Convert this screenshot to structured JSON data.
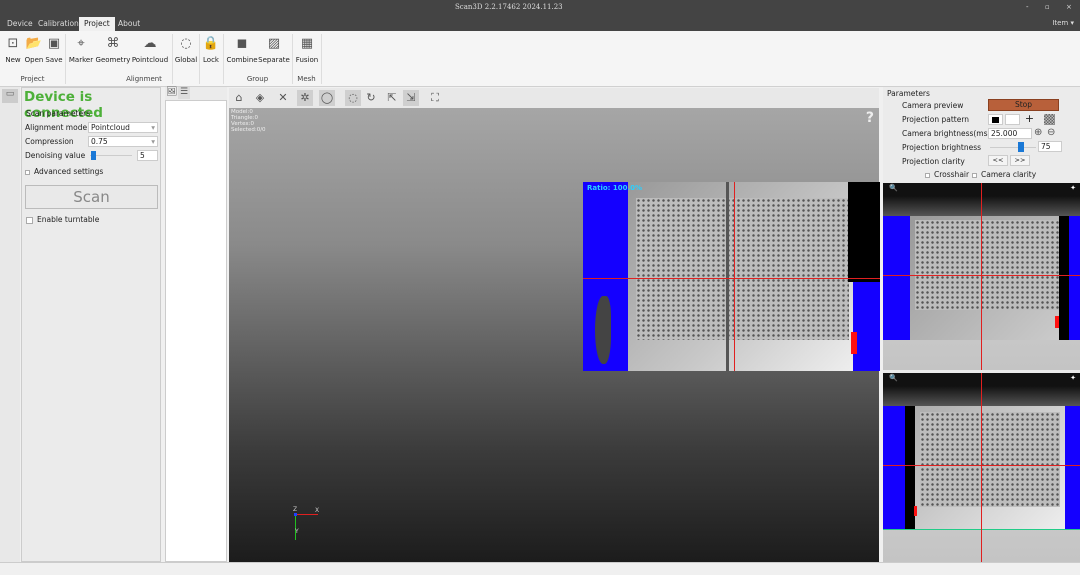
{
  "window": {
    "title": "Scan3D 2.2.17462 2024.11.23",
    "minimize": "-",
    "maximize": "▫",
    "close": "×",
    "item_menu": "Item ▾"
  },
  "tabs": [
    "Device",
    "Calibration",
    "Project",
    "About"
  ],
  "ribbon": {
    "buttons": [
      {
        "label": "New",
        "icon": "new-project-icon"
      },
      {
        "label": "Open",
        "icon": "open-folder-icon"
      },
      {
        "label": "Save",
        "icon": "save-icon"
      },
      {
        "label": "Marker",
        "icon": "marker-icon"
      },
      {
        "label": "Geometry",
        "icon": "geometry-icon"
      },
      {
        "label": "Pointcloud",
        "icon": "pointcloud-icon"
      },
      {
        "label": "Global",
        "icon": "global-icon"
      },
      {
        "label": "Lock",
        "icon": "lock-icon"
      },
      {
        "label": "Combine",
        "icon": "combine-icon"
      },
      {
        "label": "Separate",
        "icon": "separate-icon"
      },
      {
        "label": "Fusion",
        "icon": "fusion-icon"
      }
    ],
    "groups": [
      "Project",
      "Alignment",
      "Group",
      "Mesh"
    ]
  },
  "left": {
    "status": "Device is connected",
    "status_color": "#4db039",
    "section": "Scan parameters",
    "alignment_label": "Alignment mode",
    "alignment_value": "Pointcloud",
    "compression_label": "Compression",
    "compression_value": "0.75",
    "denoise_label": "Denoising value",
    "denoise_value": "5",
    "advanced": "Advanced settings",
    "scan": "Scan",
    "turntable": "Enable turntable"
  },
  "viewport": {
    "stats": [
      "Model:0",
      "Triangle:0",
      "Vertex:0",
      "Selected:0/0"
    ],
    "help": "?",
    "ratio": "Ratio: 100.0%",
    "axes": {
      "x": "X",
      "y": "Y",
      "z": "Z"
    }
  },
  "right": {
    "title": "Parameters",
    "camera_preview": "Camera preview",
    "stop": "Stop",
    "stop_color": "#b8603a",
    "projection_pattern": "Projection pattern",
    "camera_brightness": "Camera brightness(ms)",
    "camera_brightness_value": "25.000",
    "projection_brightness": "Projection brightness",
    "projection_brightness_value": "75",
    "projection_clarity": "Projection clarity",
    "prev": "<<",
    "next": ">>",
    "crosshair": "Crosshair",
    "camera_clarity": "Camera clarity"
  }
}
